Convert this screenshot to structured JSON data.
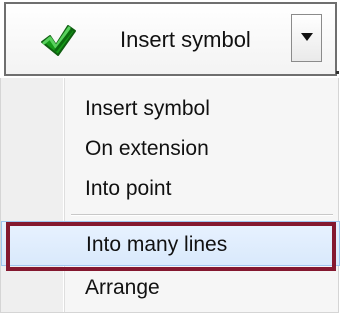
{
  "toolbar": {
    "button_label": "Insert symbol",
    "check_icon": "check-icon",
    "dropdown_icon": "chevron-down-icon"
  },
  "menu": {
    "items": [
      {
        "label": "Insert symbol"
      },
      {
        "label": "On extension"
      },
      {
        "label": "Into point"
      },
      {
        "label": "Into many lines",
        "selected": true
      },
      {
        "label": "Arrange"
      }
    ]
  },
  "colors": {
    "check_green": "#169b19",
    "highlight_border": "#84182f",
    "selected_background": "#dbeafb"
  }
}
